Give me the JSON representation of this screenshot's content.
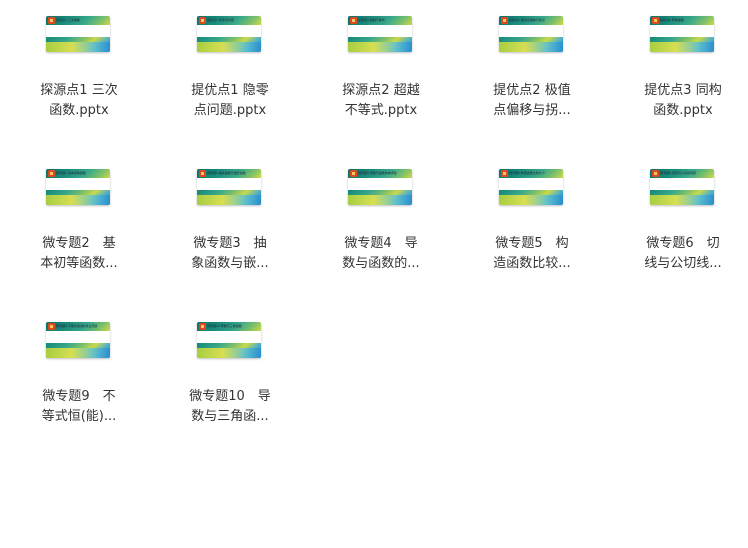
{
  "files": [
    {
      "line1": "探源点1 三次",
      "line2": "函数.pptx",
      "thumb_text": "探究点1 三次函数"
    },
    {
      "line1": "提优点1 隐零",
      "line2": "点问题.pptx",
      "thumb_text": "提优点1 隐零点问题"
    },
    {
      "line1": "探源点2 超越",
      "line2": "不等式.pptx",
      "thumb_text": "探源点2 超越不等式"
    },
    {
      "line1": "提优点2 极值",
      "line2": "点偏移与拐...",
      "thumb_text": "提优点2 极值点偏移与拐点"
    },
    {
      "line1": "提优点3 同构",
      "line2": "函数.pptx",
      "thumb_text": "提优点3 同构函数"
    },
    {
      "line1": "微专题2　基",
      "line2": "本初等函数...",
      "thumb_text": "微专题2 基本初等函数"
    },
    {
      "line1": "微专题3　抽",
      "line2": "象函数与嵌...",
      "thumb_text": "微专题3 抽象函数与嵌套函数"
    },
    {
      "line1": "微专题4　导",
      "line2": "数与函数的...",
      "thumb_text": "微专题4 导数与函数的单调性"
    },
    {
      "line1": "微专题5　构",
      "line2": "造函数比较...",
      "thumb_text": "微专题5 构造函数比较大小"
    },
    {
      "line1": "微专题6　切",
      "line2": "线与公切线...",
      "thumb_text": "微专题6 切线与公切线问题"
    },
    {
      "line1": "微专题9　不",
      "line2": "等式恒(能)...",
      "thumb_text": "微专题9 不等式恒(能)成立问题"
    },
    {
      "line1": "微专题10　导",
      "line2": "数与三角函...",
      "thumb_text": "微专题10 导数与三角函数"
    }
  ]
}
